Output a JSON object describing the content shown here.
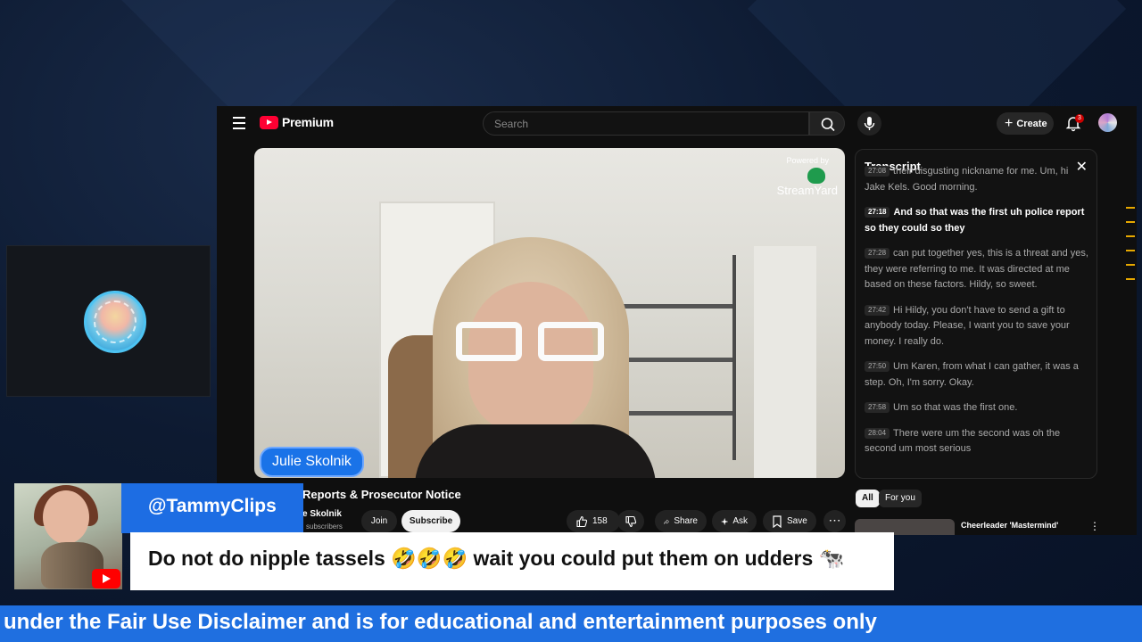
{
  "youtube": {
    "brand": "Premium",
    "search_placeholder": "Search",
    "create_label": "Create",
    "notification_count": "3",
    "video": {
      "powered_by": "Powered by",
      "streamyard": "StreamYard",
      "nameplate": "Julie Skolnik",
      "title": "Reports & Prosecutor Notice",
      "channel": "e Skolnik",
      "subscribers": "subscribers",
      "join_label": "Join",
      "subscribe_label": "Subscribe",
      "likes": "158",
      "share_label": "Share",
      "ask_label": "Ask",
      "save_label": "Save"
    },
    "transcript": {
      "heading": "Transcript",
      "segments": [
        {
          "time": "27:08",
          "text": "their disgusting nickname for me. Um, hi Jake Kels. Good morning.",
          "active": false
        },
        {
          "time": "27:18",
          "text": "And so that was the first uh police report so they could so they",
          "active": true
        },
        {
          "time": "27:28",
          "text": "can put together yes, this is a threat and yes, they were referring to me. It was directed at me based on these factors. Hildy, so sweet.",
          "active": false
        },
        {
          "time": "27:42",
          "text": "Hi Hildy, you don't have to send a gift to anybody today. Please, I want you to save your money. I really do.",
          "active": false
        },
        {
          "time": "27:50",
          "text": "Um Karen, from what I can gather, it was a step. Oh, I'm sorry. Okay.",
          "active": false
        },
        {
          "time": "27:58",
          "text": "Um so that was the first one.",
          "active": false
        },
        {
          "time": "28:04",
          "text": "There were um the second was oh the second um most serious",
          "active": false
        }
      ],
      "chips": [
        "All",
        "For you"
      ]
    },
    "recommendation": {
      "title": "Cheerleader 'Mastermind'"
    }
  },
  "overlay": {
    "username": "@TammyClips",
    "message": "Do not do nipple tassels 🤣🤣🤣 wait you could put them on udders 🐄",
    "ticker": "under the Fair Use Disclaimer and is for educational and entertainment purposes only"
  },
  "colors": {
    "overlay_blue": "#1d6de3",
    "youtube_red": "#ff0033",
    "page_bg": "#0d1a31"
  }
}
